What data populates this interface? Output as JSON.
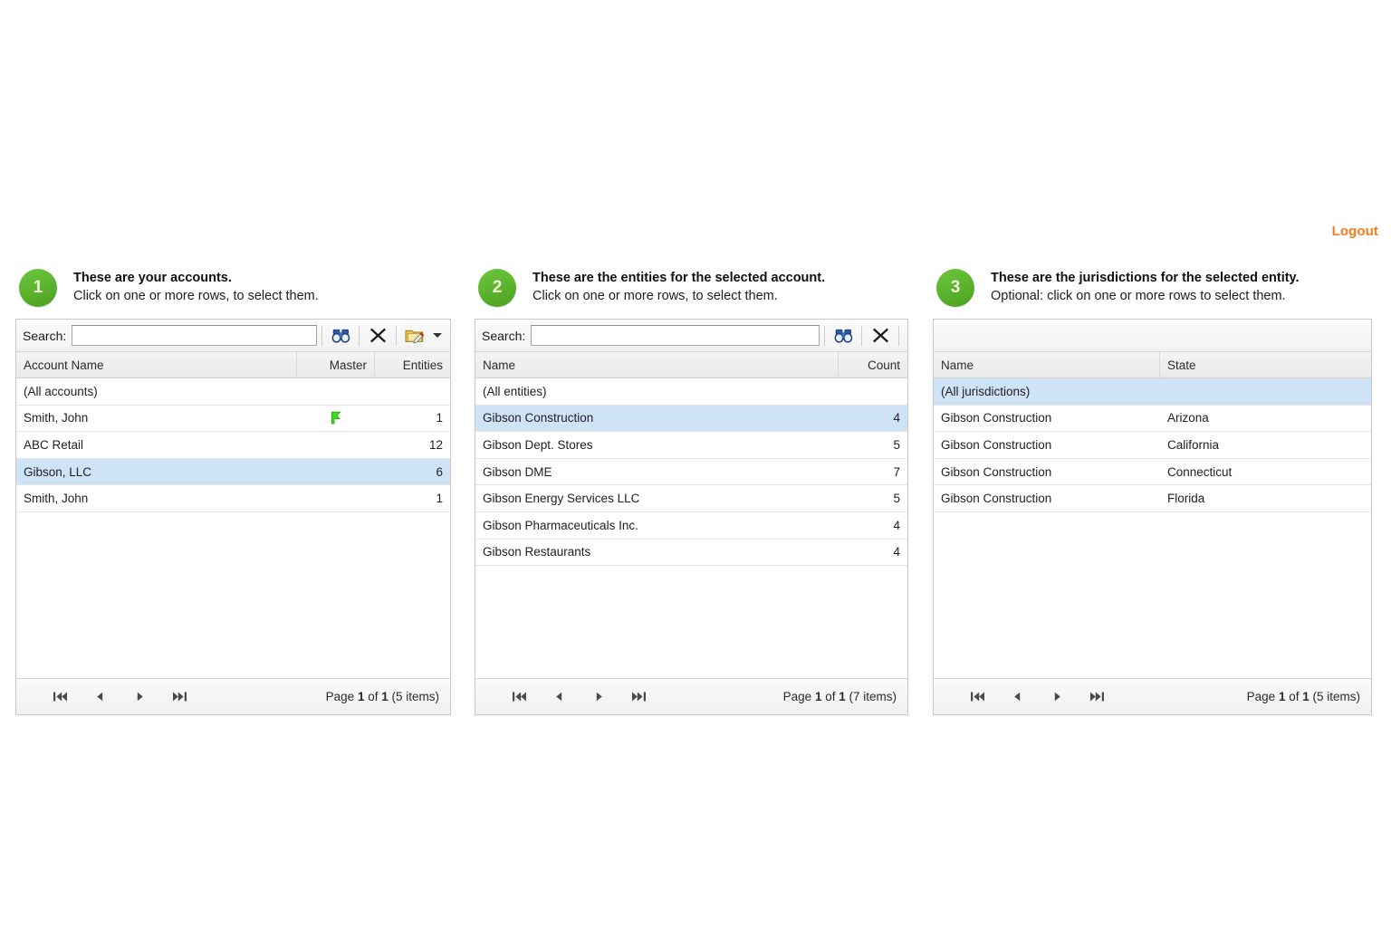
{
  "header": {
    "logout_label": "Logout"
  },
  "panels": [
    {
      "step": "1",
      "title": "These are your accounts.",
      "subtitle": "Click on one or more rows, to select them.",
      "toolbar": {
        "has_search": true,
        "search_label": "Search:",
        "search_value": "",
        "search_placeholder": "",
        "buttons": [
          "find-icon",
          "clear-icon",
          "edit-folder-icon",
          "dropdown-caret-icon"
        ]
      },
      "columns": [
        "Account Name",
        "Master",
        "Entities"
      ],
      "rows": [
        {
          "name": "(All accounts)",
          "master": "",
          "entities": "",
          "selected": false,
          "flag": false
        },
        {
          "name": "Smith, John",
          "master": "",
          "entities": "1",
          "selected": false,
          "flag": true
        },
        {
          "name": "ABC Retail",
          "master": "",
          "entities": "12",
          "selected": false,
          "flag": false
        },
        {
          "name": "Gibson, LLC",
          "master": "",
          "entities": "6",
          "selected": true,
          "flag": false
        },
        {
          "name": "Smith, John",
          "master": "",
          "entities": "1",
          "selected": false,
          "flag": false
        }
      ],
      "pager": {
        "first": "first-page-icon",
        "prev": "previous-page-icon",
        "next": "next-page-icon",
        "last": "last-page-icon",
        "page_prefix": "Page ",
        "page_current": "1",
        "page_of": " of ",
        "page_total": "1",
        "items": " (5 items)"
      }
    },
    {
      "step": "2",
      "title": "These are the entities for the selected account.",
      "subtitle": "Click on one or more rows, to select them.",
      "toolbar": {
        "has_search": true,
        "search_label": "Search:",
        "search_value": "",
        "search_placeholder": "",
        "buttons": [
          "find-icon",
          "clear-icon"
        ]
      },
      "columns": [
        "Name",
        "Count"
      ],
      "rows": [
        {
          "name": "(All entities)",
          "count": "",
          "selected": false
        },
        {
          "name": "Gibson Construction",
          "count": "4",
          "selected": true
        },
        {
          "name": "Gibson Dept. Stores",
          "count": "5",
          "selected": false
        },
        {
          "name": "Gibson DME",
          "count": "7",
          "selected": false
        },
        {
          "name": "Gibson Energy Services LLC",
          "count": "5",
          "selected": false
        },
        {
          "name": "Gibson Pharmaceuticals Inc.",
          "count": "4",
          "selected": false
        },
        {
          "name": "Gibson Restaurants",
          "count": "4",
          "selected": false
        }
      ],
      "pager": {
        "page_prefix": "Page ",
        "page_current": "1",
        "page_of": " of ",
        "page_total": "1",
        "items": " (7 items)"
      }
    },
    {
      "step": "3",
      "title": "These are the jurisdictions for the selected entity.",
      "subtitle": "Optional: click on one or more rows to select them.",
      "toolbar": {
        "has_search": false,
        "search_label": "",
        "search_value": "",
        "buttons": []
      },
      "columns": [
        "Name",
        "State"
      ],
      "rows": [
        {
          "name": "(All jurisdictions)",
          "state": "",
          "selected": true
        },
        {
          "name": "Gibson Construction",
          "state": "Arizona",
          "selected": false
        },
        {
          "name": "Gibson Construction",
          "state": "California",
          "selected": false
        },
        {
          "name": "Gibson Construction",
          "state": "Connecticut",
          "selected": false
        },
        {
          "name": "Gibson Construction",
          "state": "Florida",
          "selected": false
        }
      ],
      "pager": {
        "page_prefix": "Page ",
        "page_current": "1",
        "page_of": " of ",
        "page_total": "1",
        "items": " (5 items)"
      }
    }
  ],
  "colors": {
    "step_badge_green": "#5ab82e",
    "selection_blue": "#cfe3f6",
    "logout_orange": "#f97b17",
    "flag_green": "#3ddb1f"
  }
}
